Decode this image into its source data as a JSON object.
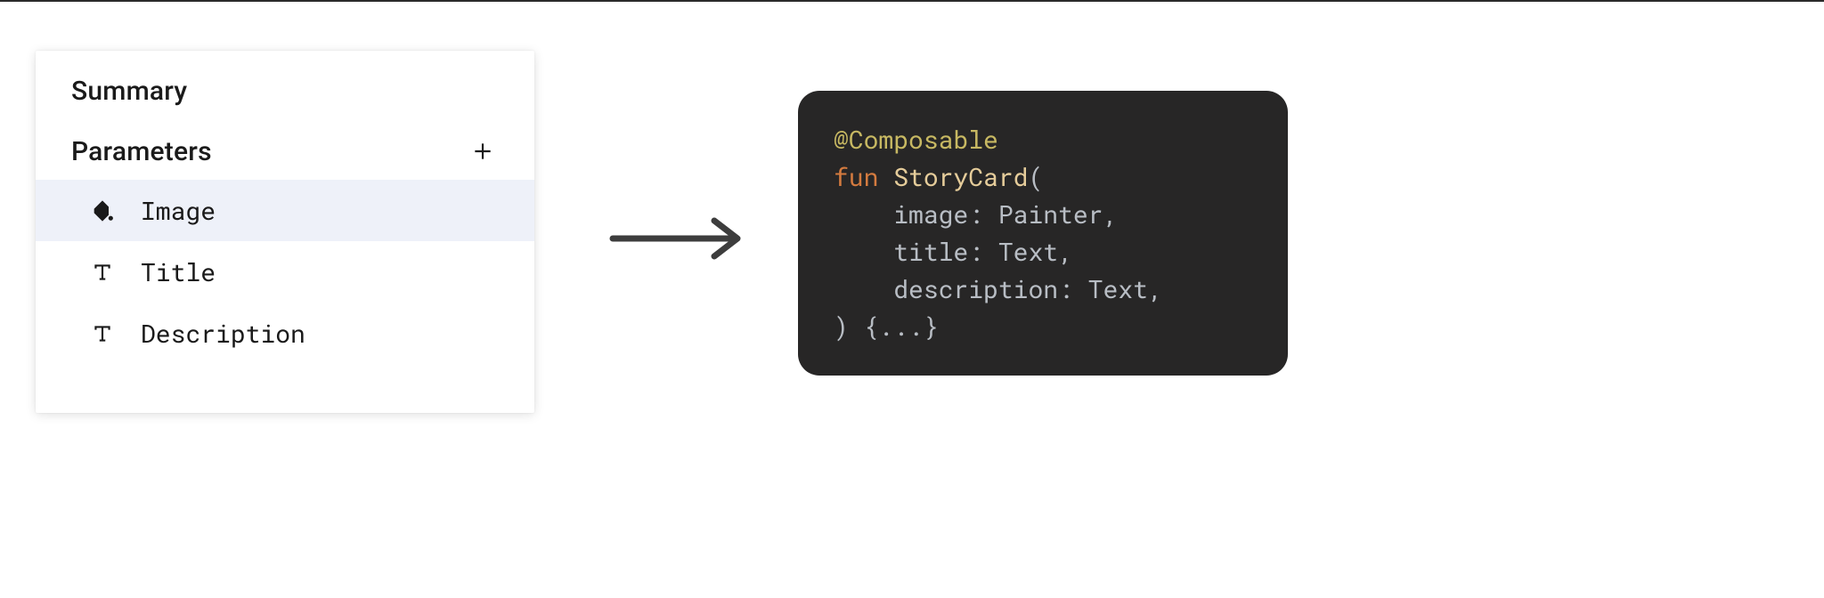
{
  "panel": {
    "summary_title": "Summary",
    "parameters_title": "Parameters",
    "params": [
      {
        "icon": "paint-bucket",
        "label": "Image",
        "selected": true
      },
      {
        "icon": "text-t",
        "label": "Title",
        "selected": false
      },
      {
        "icon": "text-t",
        "label": "Description",
        "selected": false
      }
    ]
  },
  "code": {
    "annotation": "@Composable",
    "keyword": "fun",
    "funcname": "StoryCard",
    "open_paren": "(",
    "params": [
      {
        "name": "image",
        "type": "Painter"
      },
      {
        "name": "title",
        "type": "Text"
      },
      {
        "name": "description",
        "type": "Text"
      }
    ],
    "close_paren": ")",
    "body": "{...}"
  }
}
